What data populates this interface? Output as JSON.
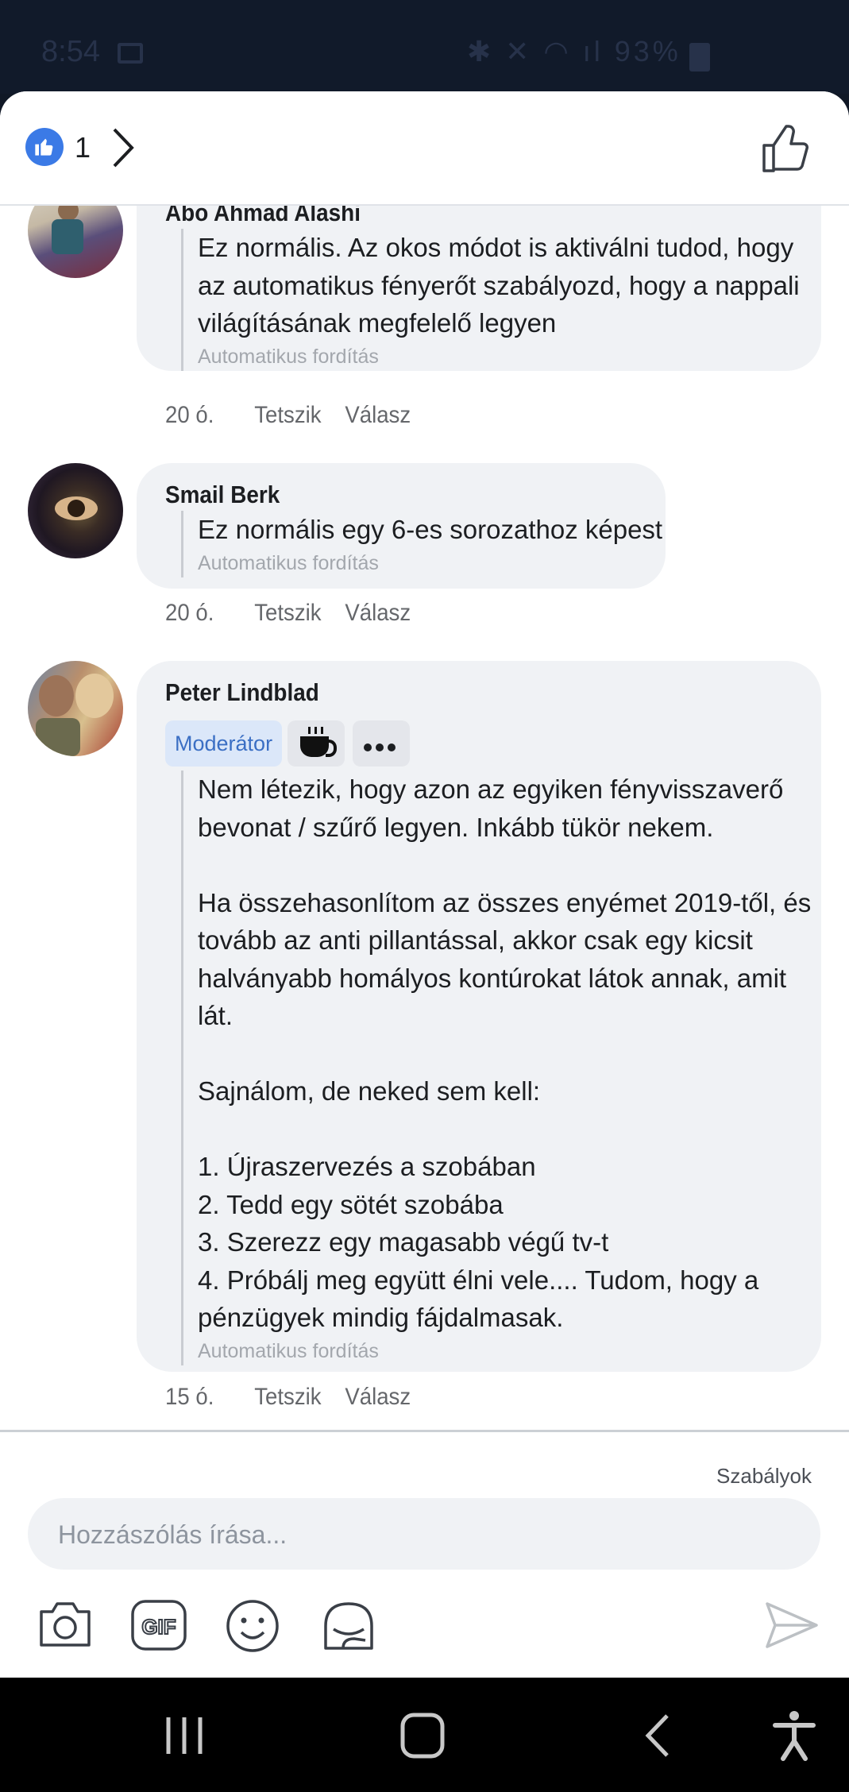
{
  "status_bar": {
    "time": "8:54",
    "battery": "93%"
  },
  "header": {
    "reaction_count": "1"
  },
  "comments": [
    {
      "author": "Abo Ahmad Alashi",
      "text": "Ez normális. Az okos módot is aktiválni tudod, hogy\naz automatikus fényerőt szabályozd, hogy a nappali\nvilágításának megfelelő legyen",
      "translation_label": "Automatikus fordítás",
      "time": "20 ó.",
      "like_label": "Tetszik",
      "reply_label": "Válasz"
    },
    {
      "author": "Smail Berk",
      "text": "Ez normális egy 6-es sorozathoz képest",
      "translation_label": "Automatikus fordítás",
      "time": "20 ó.",
      "like_label": "Tetszik",
      "reply_label": "Válasz"
    },
    {
      "author": "Peter Lindblad",
      "badge": "Moderátor",
      "text": "Nem létezik, hogy azon az egyiken fényvisszaverő\nbevonat / szűrő legyen. Inkább tükör nekem.\n\nHa összehasonlítom az összes enyémet 2019-től, és\ntovább az anti pillantással, akkor csak egy kicsit\nhalványabb homályos kontúrokat látok annak, amit\nlát.\n\nSajnálom, de neked sem kell:\n\n1. Újraszervezés a szobában\n2. Tedd egy sötét szobába\n3. Szerezz egy magasabb végű tv-t\n4. Próbálj meg együtt élni vele.... Tudom, hogy a\npénzügyek mindig fájdalmasak.",
      "translation_label": "Automatikus fordítás",
      "time": "15 ó.",
      "like_label": "Tetszik",
      "reply_label": "Válasz"
    }
  ],
  "footer": {
    "rules_link": "Szabályok",
    "composer_placeholder": "Hozzászólás írása..."
  },
  "colors": {
    "accent": "#3b7ae6",
    "bubble": "#f0f2f5",
    "moderator_badge_bg": "#dbe7f9",
    "moderator_badge_text": "#3b6fc4"
  }
}
